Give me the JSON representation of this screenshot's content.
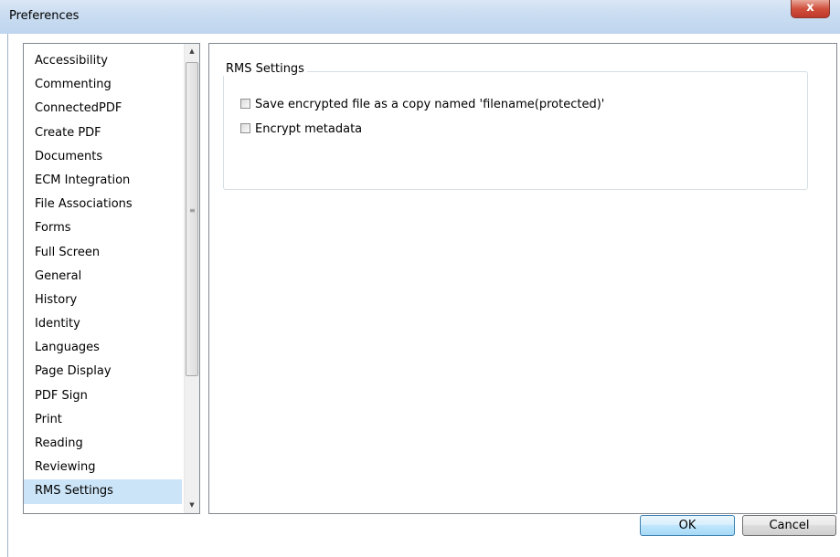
{
  "window": {
    "title": "Preferences",
    "close_glyph": "x"
  },
  "sidebar": {
    "items": [
      {
        "label": "Accessibility"
      },
      {
        "label": "Commenting"
      },
      {
        "label": "ConnectedPDF"
      },
      {
        "label": "Create PDF"
      },
      {
        "label": "Documents"
      },
      {
        "label": "ECM Integration"
      },
      {
        "label": "File Associations"
      },
      {
        "label": "Forms"
      },
      {
        "label": "Full Screen"
      },
      {
        "label": "General"
      },
      {
        "label": "History"
      },
      {
        "label": "Identity"
      },
      {
        "label": "Languages"
      },
      {
        "label": "Page Display"
      },
      {
        "label": "PDF Sign"
      },
      {
        "label": "Print"
      },
      {
        "label": "Reading"
      },
      {
        "label": "Reviewing"
      },
      {
        "label": "RMS Settings"
      }
    ],
    "selected": "RMS Settings",
    "scroll_up_glyph": "▲",
    "scroll_down_glyph": "▼",
    "thumb_grip": "≡"
  },
  "rms": {
    "group_title": "RMS Settings",
    "options": [
      {
        "label": "Save encrypted file as a copy named 'filename(protected)'",
        "checked": false
      },
      {
        "label": "Encrypt metadata",
        "checked": false
      }
    ]
  },
  "buttons": {
    "ok_label": "OK",
    "cancel_label": "Cancel"
  },
  "colors": {
    "selection": "#cce4f7",
    "close_button": "#c0392b",
    "titlebar": "#c9dcf1"
  }
}
